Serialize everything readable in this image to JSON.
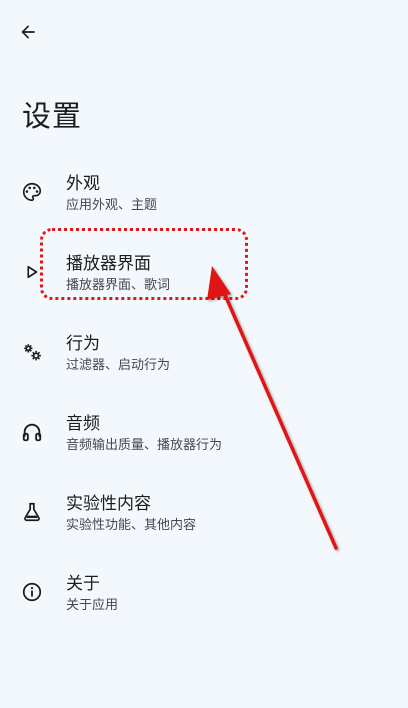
{
  "header": {
    "back_icon": "arrow-back-icon",
    "title": "设置"
  },
  "items": [
    {
      "icon": "palette-icon",
      "title": "外观",
      "subtitle": "应用外观、主题"
    },
    {
      "icon": "play-outline-icon",
      "title": "播放器界面",
      "subtitle": "播放器界面、歌词"
    },
    {
      "icon": "gears-icon",
      "title": "行为",
      "subtitle": "过滤器、启动行为"
    },
    {
      "icon": "headphones-icon",
      "title": "音频",
      "subtitle": "音频输出质量、播放器行为"
    },
    {
      "icon": "flask-icon",
      "title": "实验性内容",
      "subtitle": "实验性功能、其他内容"
    },
    {
      "icon": "info-icon",
      "title": "关于",
      "subtitle": "关于应用"
    }
  ],
  "annotation": {
    "color": "#e01818"
  }
}
